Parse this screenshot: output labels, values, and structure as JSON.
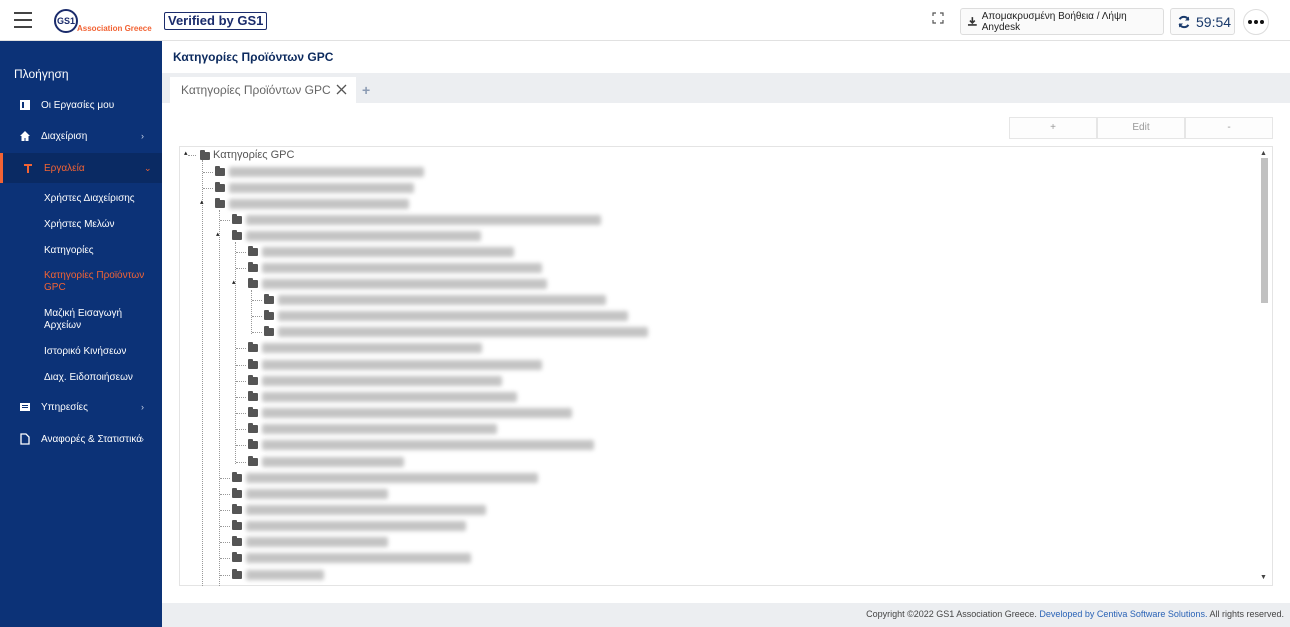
{
  "header": {
    "logo_gs1": "GS1",
    "logo_subtitle": "Association Greece",
    "verified_label": "Verified by GS1",
    "anydesk_label": "Απομακρυσμένη Βοήθεια / Λήψη Anydesk",
    "timer_value": "59:54"
  },
  "sidebar": {
    "title": "Πλοήγηση",
    "items": [
      {
        "label": "Οι Εργασίες μου",
        "icon": "tasks-icon"
      },
      {
        "label": "Διαχείριση",
        "icon": "home-icon",
        "chevron": "›"
      },
      {
        "label": "Εργαλεία",
        "icon": "tools-icon",
        "chevron": "⌄"
      },
      {
        "label": "Υπηρεσίες",
        "icon": "services-icon",
        "chevron": "›"
      },
      {
        "label": "Αναφορές & Στατιστικά",
        "icon": "reports-icon",
        "chevron": "›"
      }
    ],
    "subitems": [
      "Χρήστες Διαχείρισης",
      "Χρήστες Μελών",
      "Κατηγορίες",
      "Κατηγορίες Προϊόντων GPC",
      "Μαζική Εισαγωγή Αρχείων",
      "Ιστορικό Κινήσεων",
      "Διαχ. Ειδοποιήσεων"
    ]
  },
  "main": {
    "page_title": "Κατηγορίες Προϊόντων GPC",
    "tab_label": "Κατηγορίες Προϊόντων GPC",
    "tab_add": "+",
    "tools": {
      "add": "+",
      "edit": "Edit",
      "remove": "-"
    },
    "tree_root": "Κατηγορίες GPC"
  },
  "footer": {
    "copyright": "Copyright ©2022 GS1 Association Greece.",
    "developer": "Developed by Centiva Software Solutions.",
    "rights": "All rights reserved."
  },
  "colors": {
    "sidebar_bg": "#0c3277",
    "accent": "#f26334",
    "title": "#0c2a5e"
  }
}
